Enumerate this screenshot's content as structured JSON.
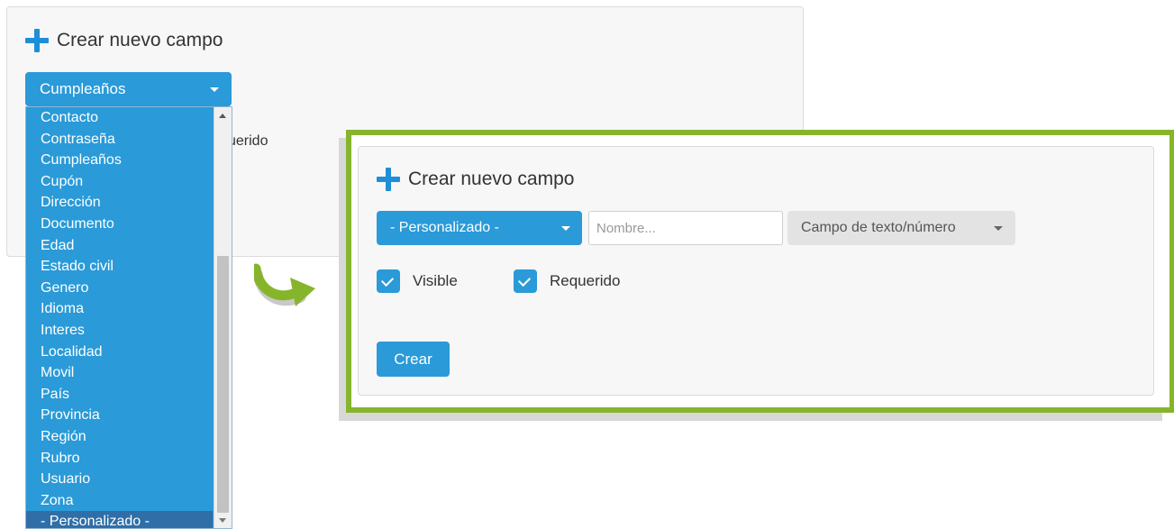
{
  "background_panel": {
    "title": "Crear nuevo campo",
    "dropdown_selected": "Cumpleaños",
    "partial_label": "uerido"
  },
  "dropdown": {
    "options": [
      "Contacto",
      "Contraseña",
      "Cumpleaños",
      "Cupón",
      "Dirección",
      "Documento",
      "Edad",
      "Estado civil",
      "Genero",
      "Idioma",
      "Interes",
      "Localidad",
      "Movil",
      "País",
      "Provincia",
      "Región",
      "Rubro",
      "Usuario",
      "Zona",
      "- Personalizado -"
    ],
    "highlighted": "- Personalizado -"
  },
  "form": {
    "title": "Crear nuevo campo",
    "type_selected": "- Personalizado -",
    "name_placeholder": "Nombre...",
    "field_type": "Campo de texto/número",
    "visible_label": "Visible",
    "visible_checked": true,
    "required_label": "Requerido",
    "required_checked": true,
    "submit_label": "Crear"
  },
  "colors": {
    "primary": "#2a9ad8",
    "selected_option": "#2f6ea7",
    "highlight_frame": "#86b52c",
    "arrow_green": "#86b52c",
    "panel_background": "#f7f7f7"
  },
  "icons": {
    "title_icon": "plus-icon",
    "transition_icon": "curved-arrow-icon",
    "caret_icon": "chevron-down-icon",
    "check_icon": "checkmark-icon"
  }
}
